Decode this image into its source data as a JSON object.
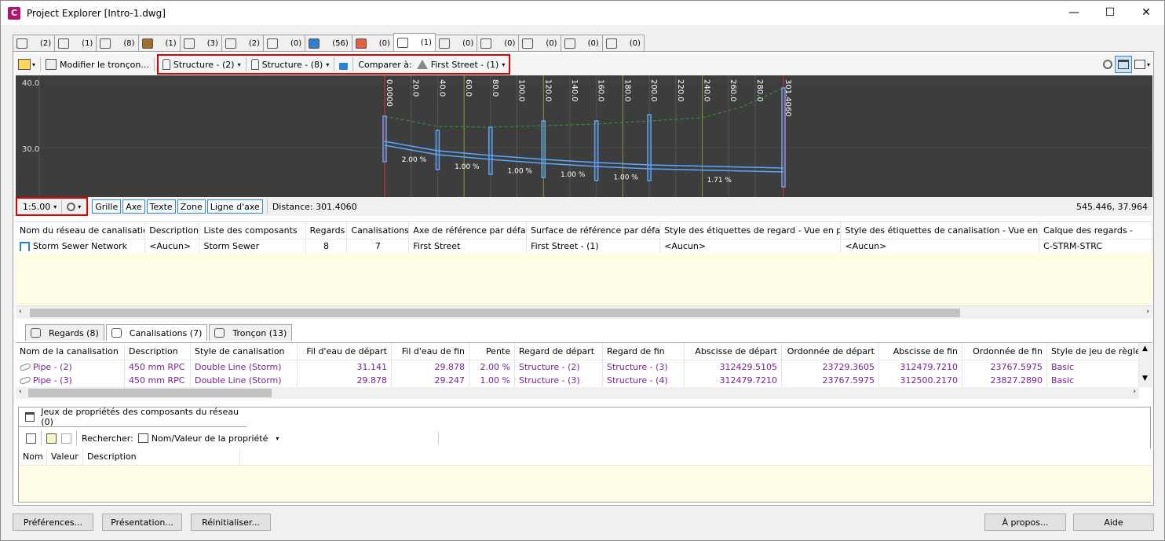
{
  "window": {
    "title": "Project Explorer [Intro-1.dwg]",
    "app_letter": "C",
    "minimize": "—",
    "maximize": "☐",
    "close": "✕"
  },
  "top_tabs": [
    {
      "icon": "alignment-icon",
      "count": "(2)"
    },
    {
      "icon": "site-icon",
      "count": "(1)"
    },
    {
      "icon": "profile-icon",
      "count": "(8)"
    },
    {
      "icon": "surface-icon",
      "count": "(1)"
    },
    {
      "icon": "cogo-icon",
      "count": "(3)"
    },
    {
      "icon": "parcel-icon",
      "count": "(2)"
    },
    {
      "icon": "corridor-icon",
      "count": "(0)"
    },
    {
      "icon": "pipe-network-icon",
      "count": "(56)"
    },
    {
      "icon": "grading-icon",
      "count": "(0)"
    },
    {
      "icon": "structure-network-icon",
      "count": "(1)"
    },
    {
      "icon": "pressure-network-icon",
      "count": "(0)"
    },
    {
      "icon": "sample-line-icon",
      "count": "(0)"
    },
    {
      "icon": "view-frame-icon",
      "count": "(0)"
    },
    {
      "icon": "sheet-icon",
      "count": "(0)"
    },
    {
      "icon": "table-icon",
      "count": "(0)"
    }
  ],
  "toolbar": {
    "modify_label": "Modifier le tronçon...",
    "structure_start": "Structure - (2)",
    "structure_end": "Structure - (8)",
    "compare_label": "Comparer à:",
    "compare_value": "First Street - (1)"
  },
  "profile": {
    "y_labels": [
      "40.0",
      "30.0"
    ],
    "stations": [
      "0.0000",
      "20.0",
      "40.0",
      "60.0",
      "80.0",
      "100.0",
      "120.0",
      "140.0",
      "160.0",
      "180.0",
      "200.0",
      "220.0",
      "240.0",
      "260.0",
      "280.0",
      "301.4060"
    ],
    "slopes": [
      "2.00 %",
      "1.00 %",
      "1.00 %",
      "1.00 %",
      "1.00 %",
      "1.71 %"
    ]
  },
  "statusbar": {
    "scale": "1:5.00",
    "grid": "Grille",
    "axis": "Axe",
    "text": "Texte",
    "zone": "Zone",
    "centerline": "Ligne d'axe",
    "distance": "Distance: 301.4060",
    "coords": "545.446, 37.964"
  },
  "network_table": {
    "headers": [
      "Nom du réseau de canalisations",
      "Description",
      "Liste des composants",
      "Regards",
      "Canalisations",
      "Axe de référence par défaut",
      "Surface de référence par défaut",
      "Style des étiquettes de regard - Vue en plan",
      "Style des étiquettes de canalisation - Vue en plan",
      "Calque des regards -"
    ],
    "row": [
      "Storm Sewer Network",
      "<Aucun>",
      "Storm Sewer",
      "8",
      "7",
      "First Street",
      "First Street - (1)",
      "<Aucun>",
      "<Aucun>",
      "C-STRM-STRC"
    ]
  },
  "mid_tabs": [
    {
      "label": "Regards (8)"
    },
    {
      "label": "Canalisations (7)"
    },
    {
      "label": "Tronçon (13)"
    }
  ],
  "pipe_table": {
    "headers": [
      "Nom de la canalisation",
      "Description",
      "Style de canalisation",
      "Fil d'eau de départ",
      "Fil d'eau de fin",
      "Pente",
      "Regard de départ",
      "Regard de fin",
      "Abscisse de départ",
      "Ordonnée de départ",
      "Abscisse de fin",
      "Ordonnée de fin",
      "Style de jeu de règles"
    ],
    "rows": [
      [
        "Pipe - (2)",
        "450 mm RPC",
        "Double Line (Storm)",
        "31.141",
        "29.878",
        "2.00 %",
        "Structure - (2)",
        "Structure - (3)",
        "312429.5105",
        "23729.3605",
        "312479.7210",
        "23767.5975",
        "Basic"
      ],
      [
        "Pipe - (3)",
        "450 mm RPC",
        "Double Line (Storm)",
        "29.878",
        "29.247",
        "1.00 %",
        "Structure - (3)",
        "Structure - (4)",
        "312479.7210",
        "23767.5975",
        "312500.2170",
        "23827.2890",
        "Basic"
      ]
    ]
  },
  "props": {
    "tab": "Jeux de propriétés des composants du réseau (0)",
    "search_label": "Rechercher:",
    "search_value": "Nom/Valeur de la propriété",
    "headers": [
      "Nom",
      "Valeur",
      "Description"
    ]
  },
  "buttons": {
    "preferences": "Préférences...",
    "presentation": "Présentation...",
    "reset": "Réinitialiser...",
    "about": "À propos...",
    "help": "Aide"
  }
}
